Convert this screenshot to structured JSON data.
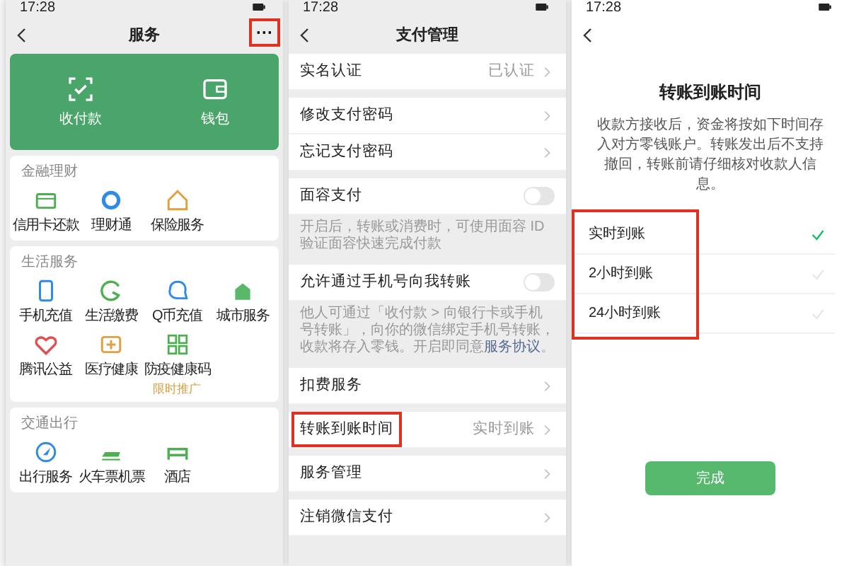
{
  "services_screen": {
    "status_time": "17:28",
    "title": "服务",
    "more_button": {
      "label": "···",
      "highlighted": true
    },
    "wallet_card": [
      {
        "label": "收付款"
      },
      {
        "label": "钱包"
      }
    ],
    "sections": [
      {
        "title": "金融理财",
        "items": [
          {
            "label": "信用卡还款"
          },
          {
            "label": "理财通"
          },
          {
            "label": "保险服务"
          }
        ]
      },
      {
        "title": "生活服务",
        "items": [
          {
            "label": "手机充值"
          },
          {
            "label": "生活缴费"
          },
          {
            "label": "Q币充值"
          },
          {
            "label": "城市服务"
          },
          {
            "label": "腾讯公益"
          },
          {
            "label": "医疗健康"
          },
          {
            "label": "防疫健康码",
            "badge": "限时推广"
          }
        ]
      },
      {
        "title": "交通出行",
        "items": [
          {
            "label": "出行服务"
          },
          {
            "label": "火车票机票"
          },
          {
            "label": "酒店"
          }
        ]
      }
    ]
  },
  "payment_settings_screen": {
    "status_time": "17:28",
    "title": "支付管理",
    "groups": [
      [
        {
          "kind": "link",
          "label": "实名认证",
          "value": "已认证",
          "highlighted": false
        }
      ],
      [
        {
          "kind": "link",
          "label": "修改支付密码",
          "highlighted": false
        },
        {
          "kind": "link",
          "label": "忘记支付密码",
          "highlighted": false
        }
      ],
      [
        {
          "kind": "toggle",
          "label": "面容支付",
          "on": false,
          "note": "开启后，转账或消费时，可使用面容 ID 验证面容快速完成付款"
        }
      ],
      [
        {
          "kind": "toggle",
          "label": "允许通过手机号向我转账",
          "on": false,
          "note": "他人可通过「收付款 > 向银行卡或手机号转账」，向你的微信绑定手机号转账，收款将存入零钱。开启即同意**服务协议**。"
        }
      ],
      [
        {
          "kind": "link",
          "label": "扣费服务",
          "highlighted": false
        }
      ],
      [
        {
          "kind": "link",
          "label": "转账到账时间",
          "value": "实时到账",
          "highlighted": true
        }
      ],
      [
        {
          "kind": "link",
          "label": "服务管理",
          "highlighted": false
        }
      ],
      [
        {
          "kind": "link",
          "label": "注销微信支付",
          "highlighted": false
        }
      ]
    ]
  },
  "transfer_time_screen": {
    "status_time": "17:28",
    "title": "转账到账时间",
    "description": "收款方接收后，资金将按如下时间存入对方零钱账户。转账发出后不支持撤回，转账前请仔细核对收款人信息。",
    "options_highlighted": true,
    "options": [
      {
        "label": "实时到账",
        "selected": true
      },
      {
        "label": "2小时到账",
        "selected": false
      },
      {
        "label": "24小时到账",
        "selected": false
      }
    ],
    "done_button": "完成"
  }
}
